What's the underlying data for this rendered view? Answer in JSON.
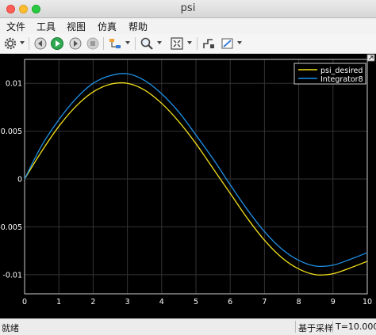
{
  "window": {
    "title": "psi"
  },
  "menu": {
    "items": [
      "文件",
      "工具",
      "视图",
      "仿真",
      "帮助"
    ]
  },
  "toolbar": {
    "buttons": [
      "settings-icon",
      "step-back-icon",
      "run-icon",
      "step-forward-icon",
      "stop-icon",
      "highlight-icon",
      "zoom-icon",
      "fit-to-view-icon",
      "signal-selector-icon",
      "style-icon"
    ]
  },
  "status": {
    "left": "就绪",
    "mode": "基于采样",
    "time": "T=10.000"
  },
  "colors": {
    "background": "#000000",
    "psi_desired": "#f2e01b",
    "integrator": "#1e90e6",
    "axes": "#cccccc",
    "grid": "#333333"
  },
  "chart_data": {
    "type": "line",
    "title": "",
    "xlabel": "",
    "ylabel": "",
    "xlim": [
      0,
      10
    ],
    "ylim": [
      -0.012,
      0.0125
    ],
    "xticks": [
      0,
      1,
      2,
      3,
      4,
      5,
      6,
      7,
      8,
      9,
      10
    ],
    "xtick_labels": [
      "0",
      "1",
      "2",
      "3",
      "4",
      "5",
      "6",
      "7",
      "8",
      "9",
      "10"
    ],
    "yticks": [
      -0.01,
      -0.005,
      0,
      0.005,
      0.01
    ],
    "ytick_labels": [
      "-0.01",
      "-0.005",
      "0",
      "0.005",
      "0.01"
    ],
    "grid": true,
    "legend_position": "top-right",
    "series": [
      {
        "name": "psi_desired",
        "x": [
          0,
          0.5,
          1,
          1.5,
          2,
          2.5,
          3,
          3.5,
          4,
          4.5,
          5,
          5.5,
          6,
          6.5,
          7,
          7.5,
          8,
          8.5,
          9,
          9.5,
          10
        ],
        "y": [
          0,
          0.0029,
          0.0055,
          0.0076,
          0.0091,
          0.0099,
          0.01,
          0.0093,
          0.0079,
          0.006,
          0.0037,
          0.0011,
          -0.0015,
          -0.0041,
          -0.0064,
          -0.0082,
          -0.0094,
          -0.01,
          -0.0099,
          -0.0093,
          -0.0086
        ]
      },
      {
        "name": "Integrator8",
        "x": [
          0,
          0.5,
          1,
          1.5,
          2,
          2.5,
          3,
          3.5,
          4,
          4.5,
          5,
          5.5,
          6,
          6.5,
          7,
          7.5,
          8,
          8.5,
          9,
          9.5,
          10
        ],
        "y": [
          0,
          0.0035,
          0.0062,
          0.0084,
          0.01,
          0.0108,
          0.011,
          0.0103,
          0.0089,
          0.007,
          0.0046,
          0.0021,
          -0.0006,
          -0.0032,
          -0.0055,
          -0.0073,
          -0.0085,
          -0.0091,
          -0.009,
          -0.0084,
          -0.0077
        ]
      }
    ]
  }
}
